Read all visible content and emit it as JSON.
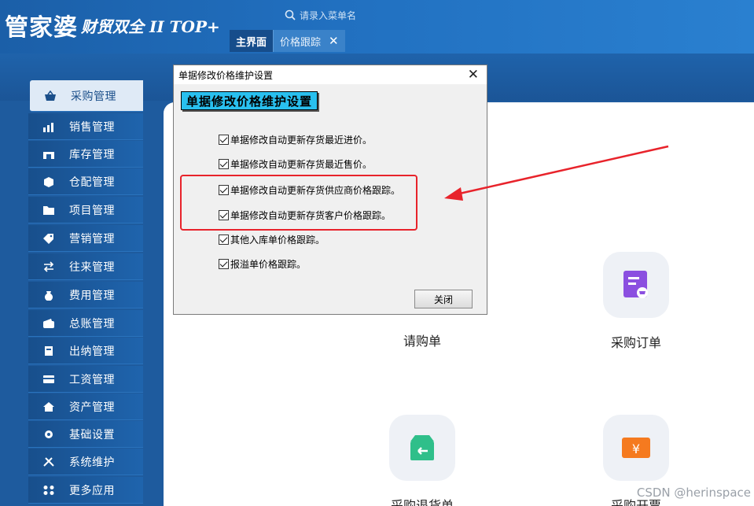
{
  "app": {
    "logo_main": "管家婆",
    "logo_sub": "财贸双全 II TOP+",
    "search_placeholder": "请录入菜单名"
  },
  "tabs": [
    {
      "label": "主界面"
    },
    {
      "label": "价格跟踪"
    }
  ],
  "tab_close_glyph": "✕",
  "sidebar": {
    "items": [
      {
        "label": "采购管理",
        "icon": "basket-icon"
      },
      {
        "label": "销售管理",
        "icon": "chart-icon"
      },
      {
        "label": "库存管理",
        "icon": "warehouse-icon"
      },
      {
        "label": "仓配管理",
        "icon": "box-icon"
      },
      {
        "label": "项目管理",
        "icon": "folder-icon"
      },
      {
        "label": "营销管理",
        "icon": "tag-icon"
      },
      {
        "label": "往来管理",
        "icon": "exchange-icon"
      },
      {
        "label": "费用管理",
        "icon": "money-bag-icon"
      },
      {
        "label": "总账管理",
        "icon": "wallet-icon"
      },
      {
        "label": "出纳管理",
        "icon": "cashier-icon"
      },
      {
        "label": "工资管理",
        "icon": "card-icon"
      },
      {
        "label": "资产管理",
        "icon": "home-icon"
      },
      {
        "label": "基础设置",
        "icon": "gear-icon"
      },
      {
        "label": "系统维护",
        "icon": "tools-icon"
      },
      {
        "label": "更多应用",
        "icon": "grid-icon"
      }
    ]
  },
  "tiles": [
    {
      "label": "请购单"
    },
    {
      "label": "采购订单"
    },
    {
      "label": "采购退货单"
    },
    {
      "label": "采购开票"
    }
  ],
  "dialog": {
    "title": "单据修改价格维护设置",
    "heading": "单据修改价格维护设置",
    "close_glyph": "✕",
    "options": [
      {
        "label": "单据修改自动更新存货最近进价。",
        "checked": true
      },
      {
        "label": "单据修改自动更新存货最近售价。",
        "checked": true
      },
      {
        "label": "单据修改自动更新存货供应商价格跟踪。",
        "checked": true
      },
      {
        "label": "单据修改自动更新存货客户价格跟踪。",
        "checked": true
      },
      {
        "label": "其他入库单价格跟踪。",
        "checked": true
      },
      {
        "label": "报溢单价格跟踪。",
        "checked": true
      }
    ],
    "close_button": "关闭"
  },
  "watermark": "CSDN @herinspace",
  "colors": {
    "accent_blue": "#29c0ef",
    "annotation_red": "#e8232b",
    "sidebar_blue": "#1f64ad",
    "tile_purple": "#8b4fe0",
    "tile_green": "#2fbf8a",
    "tile_orange": "#f57a1f"
  }
}
